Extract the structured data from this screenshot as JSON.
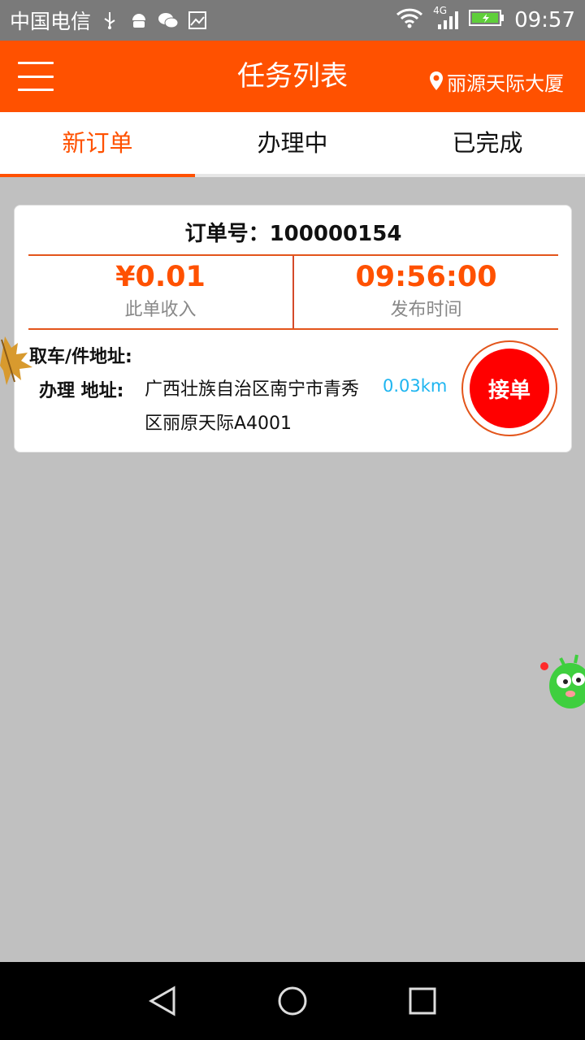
{
  "status_bar": {
    "carrier": "中国电信",
    "network": "4G",
    "time": "09:57",
    "icons": [
      "usb-icon",
      "android-icon",
      "wechat-icon",
      "gallery-icon",
      "wifi-icon",
      "signal-icon",
      "battery-icon"
    ]
  },
  "header": {
    "title": "任务列表",
    "location": "丽源天际大厦",
    "colors": {
      "primary": "#ff5100"
    }
  },
  "tabs": [
    {
      "label": "新订单",
      "active": true
    },
    {
      "label": "办理中",
      "active": false
    },
    {
      "label": "已完成",
      "active": false
    }
  ],
  "order": {
    "number_label": "订单号：",
    "number": "100000154",
    "income_value": "¥0.01",
    "income_label": "此单收入",
    "time_value": "09:56:00",
    "time_label": "发布时间",
    "address_title": "取车/件地址:",
    "address_label": "办理 地址:",
    "address": "广西壮族自治区南宁市青秀区丽原天际A4001",
    "distance": "0.03km",
    "accept_label": "接单"
  }
}
